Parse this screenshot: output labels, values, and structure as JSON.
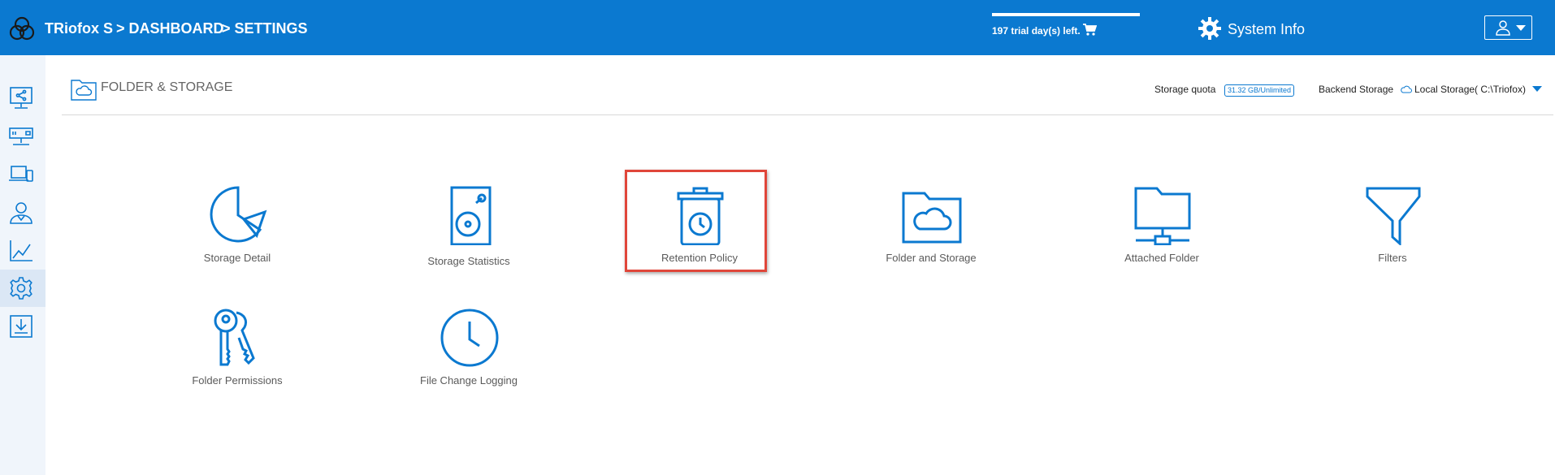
{
  "header": {
    "brand": "TRiofox S",
    "breadcrumbs": [
      {
        "label": ">  DASHBOARD"
      },
      {
        "label": ">  SETTINGS"
      }
    ],
    "trial_text": "197 trial day(s) left.",
    "system_info": "System Info"
  },
  "sidebar": {
    "items": [
      {
        "icon": "share-screen-icon"
      },
      {
        "icon": "server-icon"
      },
      {
        "icon": "devices-icon"
      },
      {
        "icon": "user-icon"
      },
      {
        "icon": "chart-icon"
      },
      {
        "icon": "settings-icon",
        "active": true
      },
      {
        "icon": "download-icon"
      }
    ]
  },
  "section": {
    "title": "FOLDER & STORAGE",
    "storage_quota_label": "Storage quota",
    "storage_quota_value": "31.32 GB/Unlimited",
    "backend_label": "Backend Storage",
    "backend_value": "Local Storage( C:\\Triofox)"
  },
  "tiles": [
    {
      "label": "Storage Detail",
      "icon": "pie-chart-icon"
    },
    {
      "label": "Storage Statistics",
      "icon": "hard-disk-icon"
    },
    {
      "label": "Retention Policy",
      "icon": "trash-clock-icon",
      "highlighted": true
    },
    {
      "label": "Folder and Storage",
      "icon": "cloud-folder-icon"
    },
    {
      "label": "Attached Folder",
      "icon": "network-folder-icon"
    },
    {
      "label": "Filters",
      "icon": "funnel-icon"
    },
    {
      "label": "Folder Permissions",
      "icon": "keys-icon"
    },
    {
      "label": "File Change Logging",
      "icon": "clock-icon"
    }
  ],
  "colors": {
    "header_bg": "#0b79d0",
    "accent": "#0b79d0",
    "highlight_border": "#e0463a",
    "sidebar_bg": "#f0f5fb"
  }
}
